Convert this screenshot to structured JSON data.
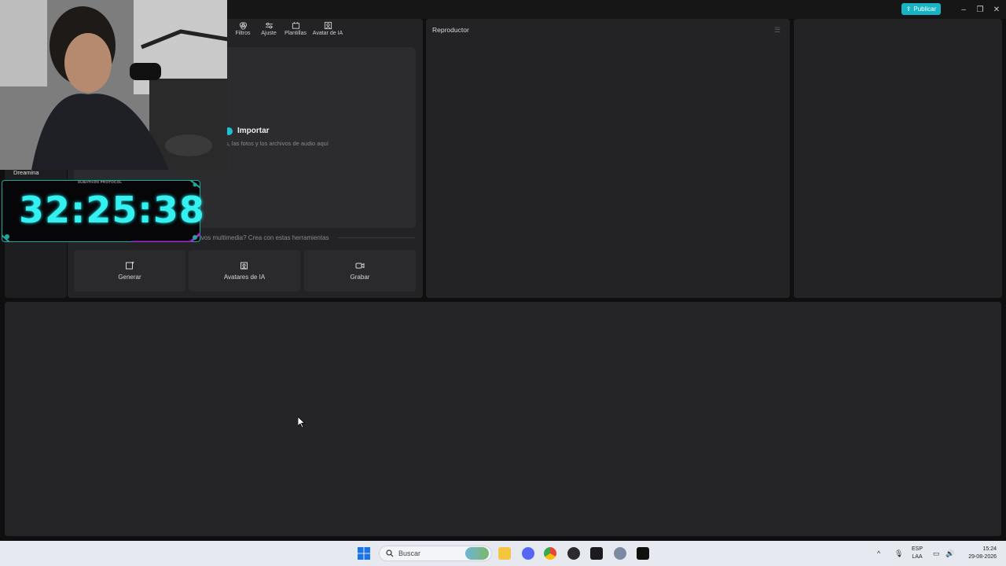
{
  "titlebar": {
    "publish_label": "Publicar"
  },
  "media_toolbar": {
    "items": [
      {
        "label": "Filtros",
        "icon": "filters-icon"
      },
      {
        "label": "Ajuste",
        "icon": "adjust-icon"
      },
      {
        "label": "Plantillas",
        "icon": "templates-icon"
      },
      {
        "label": "Avatar de IA",
        "icon": "ai-avatar-icon"
      }
    ]
  },
  "import": {
    "label": "Importar",
    "hint": "s, las fotos y los archivos de audio aquí"
  },
  "tools": {
    "divider_text": "ivos multimedia? Crea con estas herramientas",
    "cards": [
      {
        "label": "Generar",
        "icon": "generate-icon"
      },
      {
        "label": "Avatares de IA",
        "icon": "ai-avatars-icon"
      },
      {
        "label": "Grabar",
        "icon": "record-icon"
      }
    ]
  },
  "player": {
    "title": "Reproductor"
  },
  "overlay": {
    "cam_label": "Dreamina",
    "timer_header": "SUBATHON PROTOCOL",
    "timer_value": "32:25:38"
  },
  "taskbar": {
    "search_placeholder": "Buscar",
    "language": "ESP",
    "language_sub": "LAA",
    "time": "15:24",
    "date": "29-08-2026"
  },
  "colors": {
    "accent": "#18b4c6",
    "timer": "#34f0f0"
  }
}
